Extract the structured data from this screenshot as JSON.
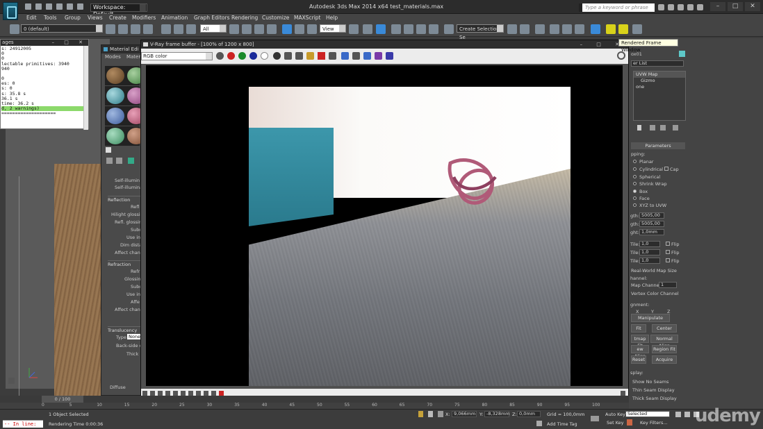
{
  "window": {
    "workspace_label": "Workspace: Default",
    "doc_title": "Autodesk 3ds Max 2014 x64        test_materials.max",
    "search_placeholder": "Type a keyword or phrase"
  },
  "menu": [
    "Edit",
    "Tools",
    "Group",
    "Views",
    "Create",
    "Modifiers",
    "Animation",
    "Graph Editors",
    "Rendering",
    "Customize",
    "MAXScript",
    "Help"
  ],
  "toolbar": {
    "layer_dropdown": "0 (default)",
    "selection_filter": "All",
    "ref_coord": "View",
    "named_selection": "Create Selection Se",
    "tooltip": "Rendered Frame Window"
  },
  "listener": {
    "title": "ages",
    "lines": [
      "s: 24912005",
      "0",
      "0",
      "lectable primitives: 3940",
      "940",
      "",
      "0",
      "es: 0",
      "s: 0",
      "s: 35.8 s",
      "36.1 s",
      "time: 36.2 s",
      "d, 2 warnings)",
      "===================="
    ]
  },
  "material_editor": {
    "title": "Material Edi",
    "menu": [
      "Modes",
      "Mater"
    ],
    "labels": [
      "Self-illumin",
      "Self-illumina",
      "Reflection",
      "Refl",
      "Hilight glossi",
      "Refl. glossin",
      "Subd",
      "Use in",
      "Dim dista",
      "Affect chan",
      "Refraction",
      "Refr",
      "Glossin",
      "Subd",
      "Use in",
      "Affe",
      "Affect chan",
      "Translucency",
      "Type",
      "Back-side co",
      "Thick",
      "Diffuse"
    ],
    "type_value": "None"
  },
  "vfb": {
    "title": "V-Ray frame buffer - [100% of 1200 x 800]",
    "channel": "RGB color"
  },
  "command_panel": {
    "object_name": "ox01",
    "modifier_list": "er List",
    "stack": [
      "UVW Map",
      "Gizmo",
      "one"
    ],
    "parameters_header": "Parameters",
    "mapping_label": "pping:",
    "mapping_options": [
      "Planar",
      "Cylindrical",
      "Spherical",
      "Shrink Wrap",
      "Box",
      "Face",
      "XYZ to UVW"
    ],
    "cap_label": "Cap",
    "length_label": "gth:",
    "length_value": "5005,00",
    "width_label": "gth:",
    "width_value": "5005,00",
    "height_label": "ght:",
    "height_value": "1,0mm",
    "tile_label": "Tile:",
    "tile_values": [
      "1,0",
      "1,0",
      "1,0"
    ],
    "flip_label": "Flip",
    "real_world": "Real-World Map Size",
    "channel_header": "hannel:",
    "map_channel_label": "Map Channel:",
    "map_channel_value": "1",
    "vertex_color_channel": "Vertex Color Channel",
    "alignment_header": "gnment:",
    "axes": [
      "X",
      "Y",
      "Z"
    ],
    "buttons": [
      "Manipulate",
      "Fit",
      "Center",
      "tmap Fit",
      "Normal Align",
      "ew Align",
      "Region Fit",
      "Reset",
      "Acquire"
    ],
    "display_header": "splay:",
    "display_options": [
      "Show No Seams",
      "Thin Seam Display",
      "Thick Seam Display"
    ]
  },
  "timeline": {
    "frame": "0 / 100",
    "ticks": [
      "0",
      "5",
      "10",
      "15",
      "20",
      "25",
      "30",
      "35",
      "40",
      "45",
      "50",
      "55",
      "60",
      "65",
      "70",
      "75",
      "80",
      "85",
      "90",
      "95",
      "100"
    ]
  },
  "status": {
    "maxscript": "-- In line:",
    "selection": "1 Object Selected",
    "rendering_time": "Rendering Time 0:00:36",
    "x_label": "X:",
    "x": "9,066mm",
    "y_label": "Y:",
    "y": "-8,328mm",
    "z_label": "Z:",
    "z": "0,0mm",
    "grid": "Grid = 100,0mm",
    "add_time_tag": "Add Time Tag",
    "auto_key": "Auto Key",
    "set_key": "Set Key",
    "key_filter": "Selected",
    "key_filters": "Key Filters..."
  },
  "watermark": "udemy",
  "colors": {
    "accent_teal": "#3a97ab",
    "highlight_yellow": "#d8d21a",
    "listener_highlight": "#8cd96b"
  }
}
